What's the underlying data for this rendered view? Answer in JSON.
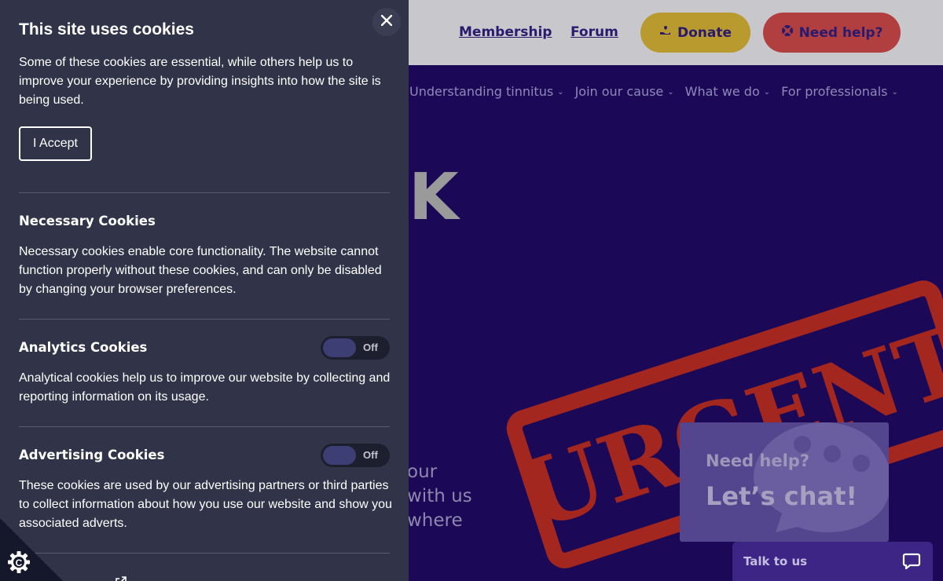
{
  "header": {
    "membership_link": "Membership",
    "forum_link": "Forum",
    "donate_button": "Donate",
    "help_button": "Need help?"
  },
  "nav": {
    "items": [
      {
        "label": "Understanding tinnitus"
      },
      {
        "label": "Join our cause"
      },
      {
        "label": "What we do"
      },
      {
        "label": "For professionals"
      }
    ]
  },
  "hero": {
    "heading_fragment": "K",
    "text_lines": [
      "our",
      "with us",
      "where"
    ],
    "stamp_text": "URGENT"
  },
  "chat_card": {
    "question": "Need help?",
    "cta": "Let’s chat!"
  },
  "talk_widget": {
    "label": "Talk to us"
  },
  "cookie_panel": {
    "title": "This site uses cookies",
    "intro": "Some of these cookies are essential, while others help us to improve your experience by providing insights into how the site is being used.",
    "accept_button": "I Accept",
    "sections": [
      {
        "title": "Necessary Cookies",
        "description": "Necessary cookies enable core functionality. The website cannot function properly without these cookies, and can only be disabled by changing your browser preferences."
      },
      {
        "title": "Analytics Cookies",
        "toggle_state": "Off",
        "description": "Analytical cookies help us to improve our website by collecting and reporting information on its usage."
      },
      {
        "title": "Advertising Cookies",
        "toggle_state": "Off",
        "description": "These cookies are used by our advertising partners or third parties to collect information about how you use our website and show you associated adverts."
      }
    ]
  },
  "icons": {
    "close": "close-icon",
    "donate": "hand-heart-icon",
    "help": "lifebuoy-icon",
    "chevron": "chevron-down-icon",
    "chat": "chat-bubble-icon",
    "cookie_settings": "cookie-gear-icon",
    "external_link": "external-link-icon"
  },
  "colors": {
    "header_bg": "#c8c8cc",
    "site_bg": "#1b0957",
    "panel_bg": "#313449",
    "donate_bg": "#b99a2e",
    "help_bg": "#b23f3f",
    "stamp_red": "#a3261f",
    "chat_card_bg": "#54468e",
    "talk_tab_bg": "#3c2585"
  }
}
